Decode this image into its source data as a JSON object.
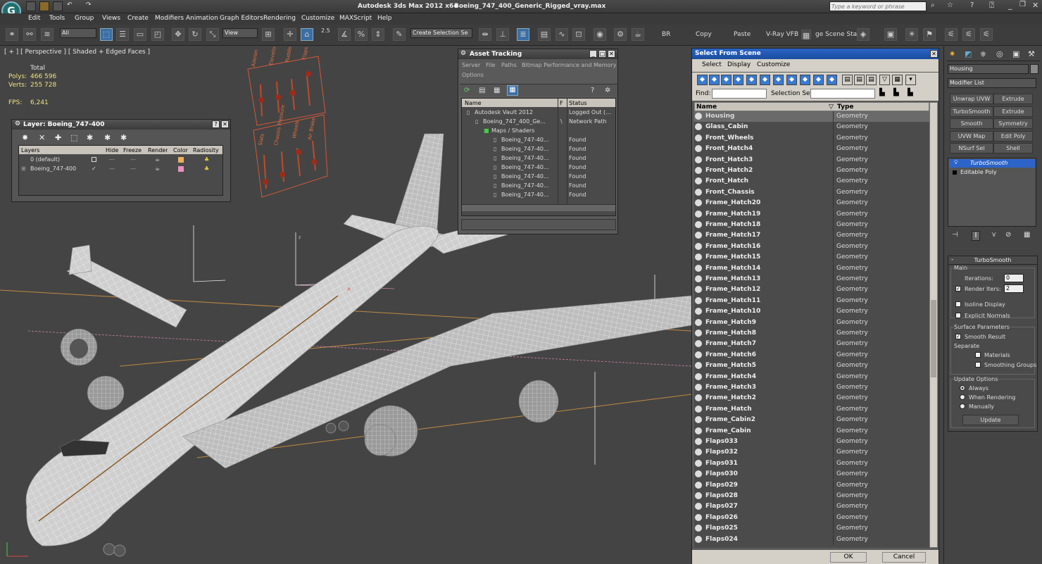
{
  "title": {
    "app": "Autodesk 3ds Max  2012 x64",
    "file": "Boeing_747_400_Generic_Rigged_vray.max",
    "search_placeholder": "Type a keyword or phrase"
  },
  "menu": [
    "Edit",
    "Tools",
    "Group",
    "Views",
    "Create",
    "Modifiers",
    "Animation",
    "Graph Editors",
    "Rendering",
    "Customize",
    "MAXScript",
    "Help"
  ],
  "toolbar": {
    "filter_select": "All",
    "ref_coord": "View",
    "snap_value": "2.5",
    "named_selection": "Create Selection Se",
    "br_label": "BR",
    "copy_label": "Copy",
    "paste_label": "Paste",
    "vray_vfb_label": "V-Ray VFB",
    "scene_states_label": "ge Scene Stat"
  },
  "viewport": {
    "label": "[ + ] [ Perspective ] [ Shaded + Edged Faces ]",
    "stats": {
      "total_label": "Total",
      "polys_label": "Polys:",
      "polys_value": "466 596",
      "verts_label": "Verts:",
      "verts_value": "255 728",
      "fps_label": "FPS:",
      "fps_value": "6,241"
    },
    "rig_labels_top": [
      "Aileron",
      "Elevator",
      "Rudder",
      "Flaps"
    ],
    "rig_labels_bottom": [
      "Slats",
      "Chassis Pressure",
      "Wheels",
      "Air Brake"
    ]
  },
  "layer_dialog": {
    "title": "Layer: Boeing_747-400",
    "columns": [
      "Layers",
      "Hide",
      "Freeze",
      "Render",
      "Color",
      "Radiosity"
    ],
    "rows": [
      {
        "name": "0 (default)",
        "color": "#e8b060"
      },
      {
        "name": "Boeing_747-400",
        "color": "#e890c0"
      }
    ]
  },
  "asset_tracking": {
    "title": "Asset Tracking",
    "menu": [
      "Server",
      "File",
      "Paths",
      "Bitmap Performance and Memory"
    ],
    "menu2": "Options",
    "columns": [
      "Name",
      "F",
      "Status"
    ],
    "rows": [
      {
        "name": "Autodesk Vault 2012",
        "f": "",
        "status": "Logged Out (..."
      },
      {
        "name": "Boeing_747_400_Ge...",
        "f": "\\",
        "status": "Network Path"
      },
      {
        "name": "Maps / Shaders",
        "f": "",
        "status": ""
      },
      {
        "name": "Boeing_747-40...",
        "f": "",
        "status": "Found"
      },
      {
        "name": "Boeing_747-40...",
        "f": "",
        "status": "Found"
      },
      {
        "name": "Boeing_747-40...",
        "f": "",
        "status": "Found"
      },
      {
        "name": "Boeing_747-40...",
        "f": "",
        "status": "Found"
      },
      {
        "name": "Boeing_747-40...",
        "f": "",
        "status": "Found"
      },
      {
        "name": "Boeing_747-40...",
        "f": "",
        "status": "Found"
      },
      {
        "name": "Boeing_747-40...",
        "f": "",
        "status": "Found"
      }
    ]
  },
  "select_from_scene": {
    "title": "Select From Scene",
    "menu": [
      "Select",
      "Display",
      "Customize"
    ],
    "find_label": "Find:",
    "selection_set_label": "Selection Set:",
    "col_name": "Name",
    "col_type": "Type",
    "items": [
      "Housing",
      "Glass_Cabin",
      "Front_Wheels",
      "Front_Hatch4",
      "Front_Hatch3",
      "Front_Hatch2",
      "Front_Hatch",
      "Front_Chassis",
      "Frame_Hatch20",
      "Frame_Hatch19",
      "Frame_Hatch18",
      "Frame_Hatch17",
      "Frame_Hatch16",
      "Frame_Hatch15",
      "Frame_Hatch14",
      "Frame_Hatch13",
      "Frame_Hatch12",
      "Frame_Hatch11",
      "Frame_Hatch10",
      "Frame_Hatch9",
      "Frame_Hatch8",
      "Frame_Hatch7",
      "Frame_Hatch6",
      "Frame_Hatch5",
      "Frame_Hatch4",
      "Frame_Hatch3",
      "Frame_Hatch2",
      "Frame_Hatch",
      "Frame_Cabin2",
      "Frame_Cabin",
      "Flaps033",
      "Flaps032",
      "Flaps031",
      "Flaps030",
      "Flaps029",
      "Flaps028",
      "Flaps027",
      "Flaps026",
      "Flaps025",
      "Flaps024"
    ],
    "type_value": "Geometry",
    "ok": "OK",
    "cancel": "Cancel"
  },
  "command_panel": {
    "object_name": "Housing",
    "modifier_list": "Modifier List",
    "buttons": [
      [
        "Unwrap UVW",
        "Extrude"
      ],
      [
        "TurboSmooth",
        "Extrude"
      ],
      [
        "Smooth",
        "Symmetry"
      ],
      [
        "UVW Map",
        "Edit Poly"
      ],
      [
        "NSurf Sel",
        "Shell"
      ]
    ],
    "stack": [
      "TurboSmooth",
      "Editable Poly"
    ],
    "rollout": {
      "title": "TurboSmooth",
      "main": "Main",
      "iterations_label": "Iterations:",
      "iterations": "0",
      "render_iters_label": "Render Iters:",
      "render_iters": "2",
      "isoline": "Isoline Display",
      "explicit": "Explicit Normals",
      "surface_params": "Surface Parameters",
      "smooth_result": "Smooth Result",
      "separate": "Separate",
      "materials": "Materials",
      "smoothing_groups": "Smoothing Groups",
      "update_options": "Update Options",
      "always": "Always",
      "when_rendering": "When Rendering",
      "manually": "Manually",
      "update": "Update"
    }
  }
}
